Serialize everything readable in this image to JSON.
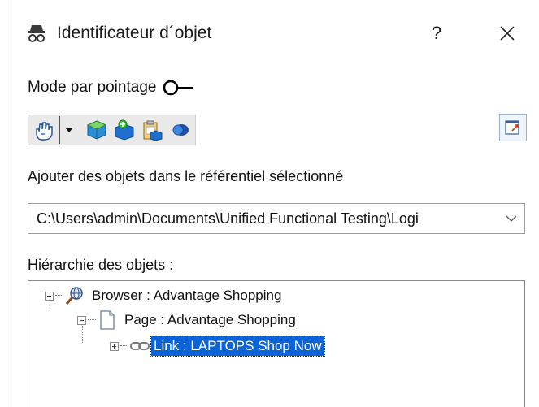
{
  "window": {
    "title": "Identificateur d´objet",
    "help_label": "?",
    "close_label": "✕"
  },
  "mode": {
    "label": "Mode par pointage",
    "toggle_on": false
  },
  "toolbar": {
    "buttons": [
      "pointing-hand-icon",
      "dropdown-arrow-icon",
      "add-object-cube-icon",
      "add-child-object-icon",
      "paste-object-icon",
      "highlight-object-icon"
    ],
    "right_button": "pin-window-icon"
  },
  "repository": {
    "label": "Ajouter des objets dans le référentiel sélectionné",
    "selected_path": "C:\\Users\\admin\\Documents\\Unified Functional Testing\\Logi"
  },
  "hierarchy": {
    "label": "Hiérarchie des objets :",
    "nodes": [
      {
        "label": "Browser : Advantage Shopping",
        "icon": "browser-globe-icon",
        "expanded": true,
        "level": 0
      },
      {
        "label": "Page : Advantage Shopping",
        "icon": "page-icon",
        "expanded": true,
        "level": 1
      },
      {
        "label": "Link : LAPTOPS Shop Now",
        "icon": "link-chain-icon",
        "expanded": false,
        "level": 2,
        "selected": true
      }
    ]
  },
  "colors": {
    "selection": "#0a64d8",
    "accent_blue": "#2b6fd1"
  }
}
